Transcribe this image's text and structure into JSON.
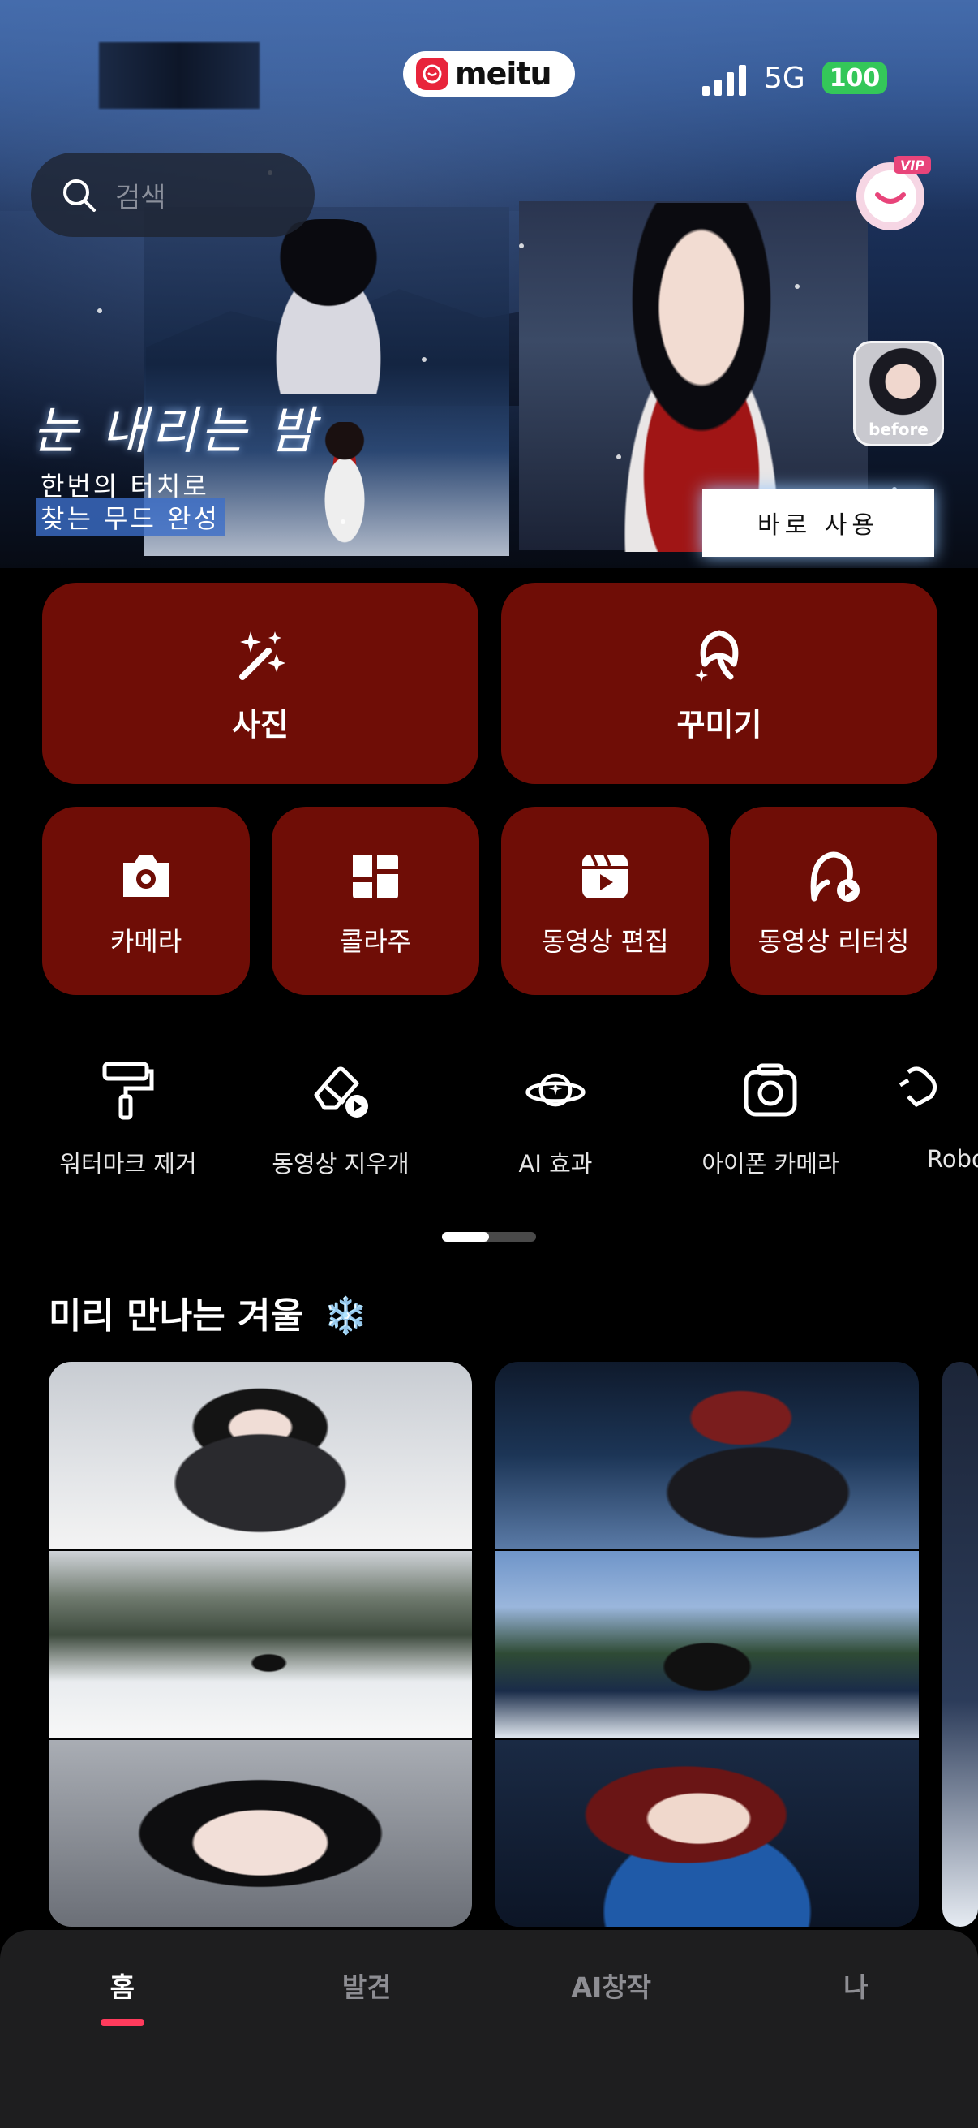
{
  "status_bar": {
    "network": "5G",
    "battery": "100"
  },
  "brand": {
    "name": "meitu"
  },
  "search": {
    "placeholder": "검색"
  },
  "banner": {
    "title": "눈 내리는 밤",
    "subtitle_line1": "한번의 터치로",
    "subtitle_line2": "찾는 무드 완성",
    "before_label": "before",
    "cta": "바로 사용"
  },
  "main_tools": [
    {
      "label": "사진",
      "icon": "magic-wand-icon"
    },
    {
      "label": "꾸미기",
      "icon": "face-beauty-icon"
    }
  ],
  "tools": [
    {
      "label": "카메라",
      "icon": "camera-icon"
    },
    {
      "label": "콜라주",
      "icon": "collage-icon"
    },
    {
      "label": "동영상 편집",
      "icon": "video-edit-icon"
    },
    {
      "label": "동영상 리터칭",
      "icon": "video-retouch-icon"
    }
  ],
  "quick_tools": [
    {
      "label": "워터마크 제거",
      "icon": "paint-roller-icon"
    },
    {
      "label": "동영상 지우개",
      "icon": "eraser-video-icon"
    },
    {
      "label": "AI 효과",
      "icon": "planet-sparkle-icon"
    },
    {
      "label": "아이폰 카메라",
      "icon": "iphone-camera-icon"
    },
    {
      "label": "Robo",
      "icon": "robot-icon"
    }
  ],
  "section": {
    "title": "미리 만나는 겨울",
    "emoji": "❄️"
  },
  "bottom_nav": [
    {
      "label": "홈",
      "active": true
    },
    {
      "label": "발견",
      "active": false
    },
    {
      "label": "AI창작",
      "active": false
    },
    {
      "label": "나",
      "active": false
    }
  ],
  "colors": {
    "tile": "#6f0d06",
    "accent": "#ff3b5c",
    "battery": "#34c759",
    "brand": "#e8243b"
  }
}
